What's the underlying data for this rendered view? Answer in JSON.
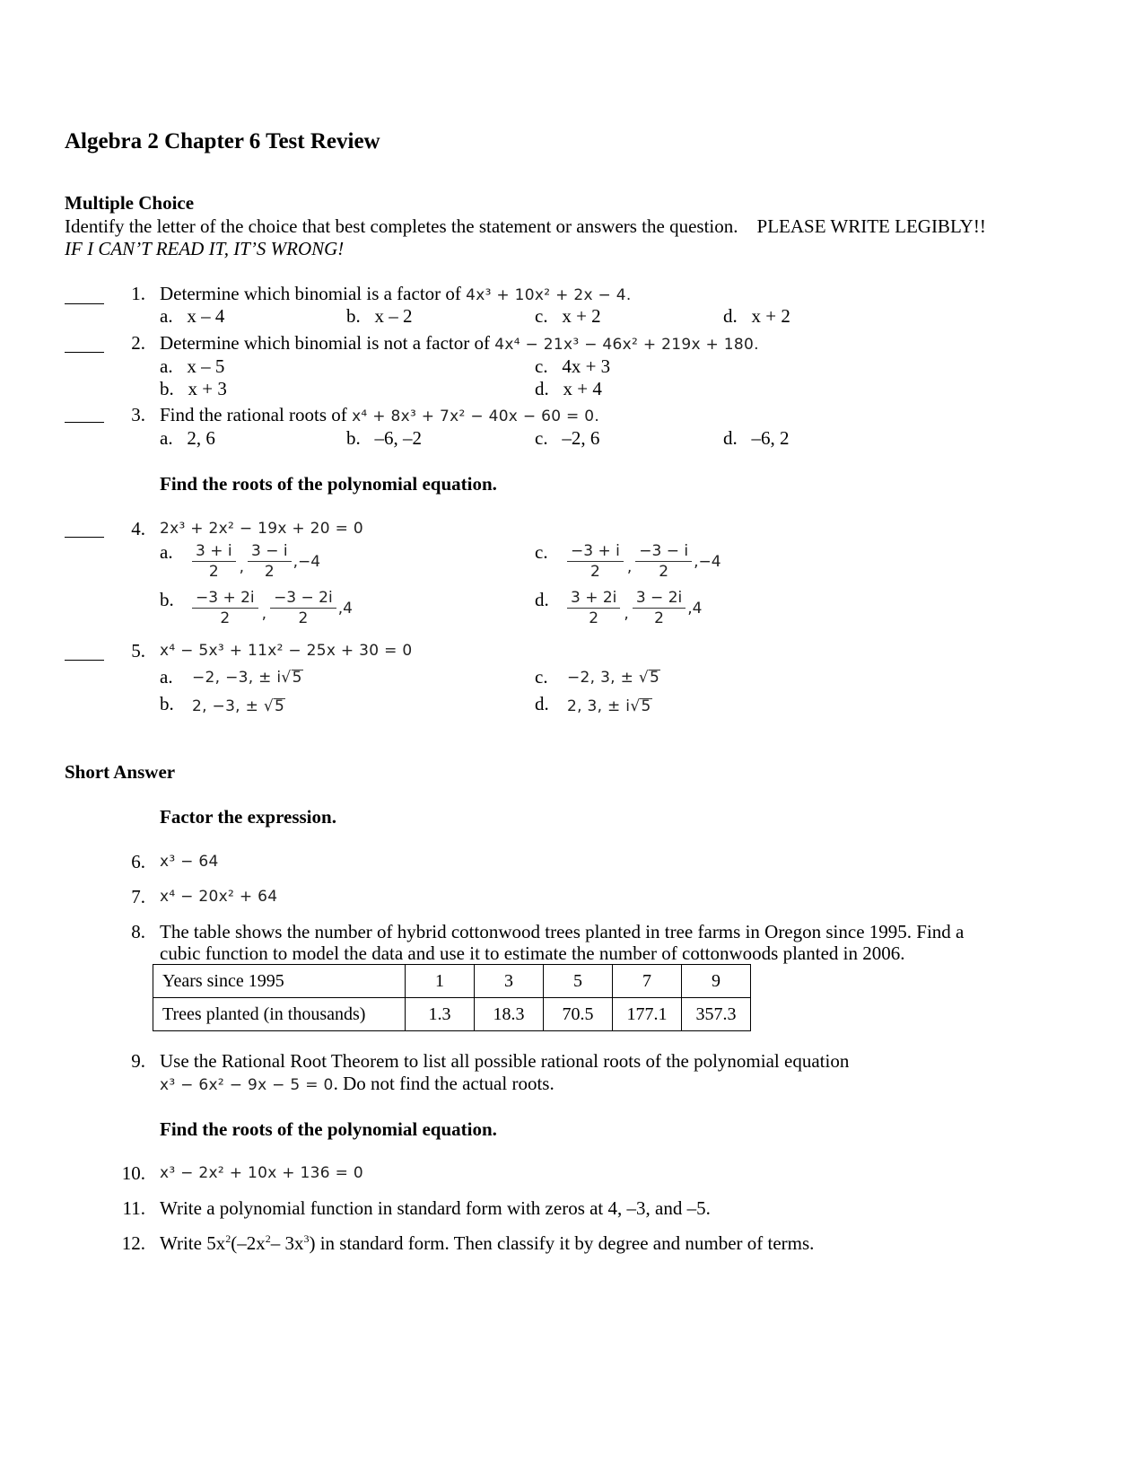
{
  "document": {
    "title": "Algebra 2 Chapter 6 Test Review",
    "multiple_choice": {
      "heading": "Multiple Choice",
      "instructions": "Identify the letter of the choice that best completes the statement or answers the question.",
      "emphasis": "PLEASE WRITE LEGIBLY!!",
      "warning": "IF I CAN’T READ IT, IT’S WRONG!",
      "questions": [
        {
          "number": "1.",
          "text": "Determine which binomial is a factor of",
          "expr": "4x³ + 10x² + 2x − 4.",
          "choices": [
            {
              "letter": "a.",
              "value": "x – 4"
            },
            {
              "letter": "b.",
              "value": "x – 2"
            },
            {
              "letter": "c.",
              "value": "x + 2"
            },
            {
              "letter": "d.",
              "value": "x + 2"
            }
          ]
        },
        {
          "number": "2.",
          "text": "Determine which binomial is not a factor of",
          "expr": "4x⁴ − 21x³ − 46x² + 219x + 180.",
          "choices": [
            {
              "letter": "a.",
              "value": "x – 5"
            },
            {
              "letter": "b.",
              "value": "x + 3"
            },
            {
              "letter": "c.",
              "value": "4x + 3"
            },
            {
              "letter": "d.",
              "value": "x + 4"
            }
          ]
        },
        {
          "number": "3.",
          "text": "Find the rational roots of",
          "expr": "x⁴ + 8x³ + 7x² − 40x − 60 = 0.",
          "choices": [
            {
              "letter": "a.",
              "value": "2, 6"
            },
            {
              "letter": "b.",
              "value": "–6, –2"
            },
            {
              "letter": "c.",
              "value": "–2, 6"
            },
            {
              "letter": "d.",
              "value": "–6, 2"
            }
          ]
        }
      ],
      "subheading": "Find the roots of the polynomial equation.",
      "questions_roots": [
        {
          "number": "4.",
          "expr": "2x³ + 2x² − 19x + 20 = 0",
          "choices": [
            {
              "letter": "a.",
              "n1": "3 + i",
              "n2": "3 − i",
              "den": "2",
              "tail": ",−4"
            },
            {
              "letter": "b.",
              "n1": "−3 + 2i",
              "n2": "−3 − 2i",
              "den": "2",
              "tail": ",4"
            },
            {
              "letter": "c.",
              "n1": "−3 + i",
              "n2": "−3 − i",
              "den": "2",
              "tail": ",−4"
            },
            {
              "letter": "d.",
              "n1": "3 + 2i",
              "n2": "3 − 2i",
              "den": "2",
              "tail": ",4"
            }
          ]
        },
        {
          "number": "5.",
          "expr": "x⁴ − 5x³ + 11x² − 25x + 30 = 0",
          "choices": [
            {
              "letter": "a.",
              "prefix": "−2, −3, ± i",
              "radicand": "5"
            },
            {
              "letter": "b.",
              "prefix": "2, −3, ± ",
              "radicand": "5"
            },
            {
              "letter": "c.",
              "prefix": "−2, 3, ± ",
              "radicand": "5"
            },
            {
              "letter": "d.",
              "prefix": "2, 3, ± i",
              "radicand": "5"
            }
          ]
        }
      ]
    },
    "short_answer": {
      "heading": "Short Answer",
      "subheading_factor": "Factor the expression.",
      "q6": {
        "number": "6.",
        "expr": "x³ − 64"
      },
      "q7": {
        "number": "7.",
        "expr": "x⁴ − 20x² + 64"
      },
      "q8": {
        "number": "8.",
        "line1": "The table shows the number of hybrid cottonwood trees planted in tree farms in Oregon since 1995. Find a",
        "line2": "cubic function to model the data and use it to estimate the number of cottonwoods planted in 2006.",
        "table": {
          "row1_label": "Years since 1995",
          "row1": [
            "1",
            "3",
            "5",
            "7",
            "9"
          ],
          "row2_label": "Trees planted (in thousands)",
          "row2": [
            "1.3",
            "18.3",
            "70.5",
            "177.1",
            "357.3"
          ]
        }
      },
      "q9": {
        "number": "9.",
        "line1": "Use the Rational Root Theorem to list all possible rational roots of the polynomial equation",
        "expr": "x³ − 6x² − 9x − 5 = 0",
        "line2_tail": ". Do not find the actual roots."
      },
      "subheading_roots": "Find the roots of the polynomial equation.",
      "q10": {
        "number": "10.",
        "expr": "x³ − 2x² + 10x + 136 = 0"
      },
      "q11": {
        "number": "11.",
        "text": "Write a polynomial function in standard form with zeros at 4, –3, and –5."
      },
      "q12": {
        "number": "12.",
        "pre": "Write 5x",
        "e1": "2",
        "mid1": "(–2x",
        "e2": "2",
        "mid2": "– 3x",
        "e3": "3",
        "post": ") in standard form. Then classify it by degree and number of terms."
      }
    }
  }
}
